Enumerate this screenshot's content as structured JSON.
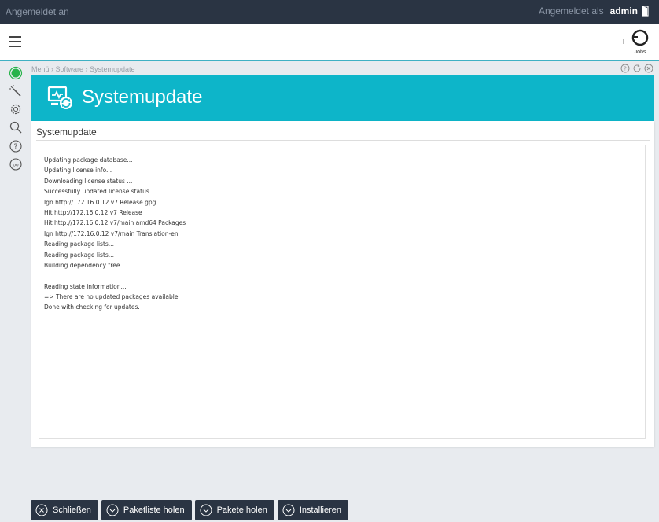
{
  "topbar": {
    "status": "Angemeldet an",
    "user_label": "Angemeldet als",
    "user_name": "admin"
  },
  "header": {
    "jobs_label": "Jobs",
    "menu_icon": "hamburger-icon"
  },
  "sidebar": {
    "icons": [
      "status-ok-icon",
      "wizard-icon",
      "settings-gear-icon",
      "search-icon",
      "help-icon",
      "oo-icon"
    ],
    "status_color": "#27b34a"
  },
  "breadcrumb": "Menü › Software › Systemupdate",
  "panel_tools": [
    "help-icon",
    "refresh-icon",
    "close-icon"
  ],
  "banner": {
    "title": "Systemupdate",
    "color": "#0db5c9"
  },
  "content": {
    "section_title": "Systemupdate",
    "log": [
      "Updating package database...",
      "Updating license info...",
      "Downloading license status ...",
      "Successfully updated license status.",
      "Ign http://172.16.0.12 v7 Release.gpg",
      "Hit http://172.16.0.12 v7 Release",
      "Hit http://172.16.0.12 v7/main amd64 Packages",
      "Ign http://172.16.0.12 v7/main Translation-en",
      "Reading package lists...",
      "Reading package lists...",
      "Building dependency tree...",
      "",
      "Reading state information...",
      "=> There are no updated packages available.",
      "Done with checking for updates."
    ]
  },
  "buttons": {
    "close": "Schließen",
    "fetch_list": "Paketliste holen",
    "fetch_packages": "Pakete holen",
    "install": "Installieren"
  },
  "colors": {
    "topbar": "#2a3443",
    "accent": "#0db5c9",
    "button": "#2a3443"
  }
}
